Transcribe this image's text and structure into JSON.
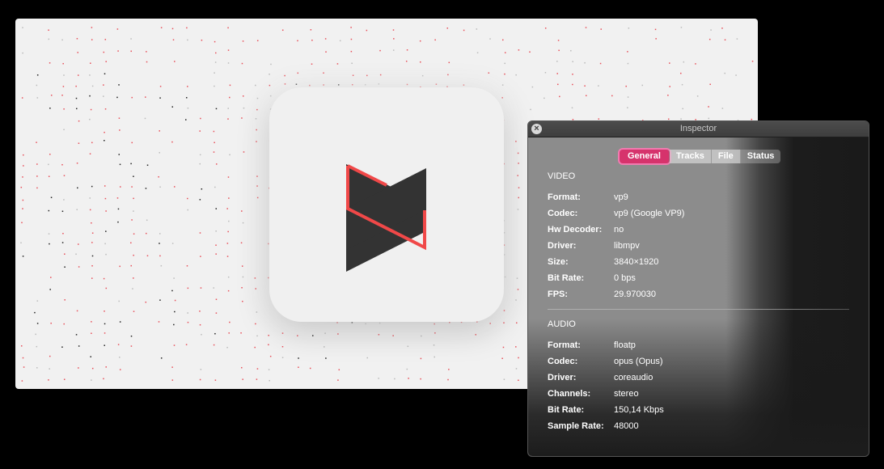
{
  "player": {
    "logo": "mpv-logo",
    "colors": {
      "background": "#f1f1f1",
      "accent_red": "#f04848",
      "logo_dark": "#333333"
    }
  },
  "inspector": {
    "title": "Inspector",
    "close_icon": "close-icon",
    "tabs": [
      {
        "label": "General",
        "active": true
      },
      {
        "label": "Tracks",
        "active": false
      },
      {
        "label": "File",
        "active": false
      },
      {
        "label": "Status",
        "active": false
      }
    ],
    "active_tab_color": "#d6336c",
    "video": {
      "title": "VIDEO",
      "rows": [
        {
          "label": "Format:",
          "value": "vp9"
        },
        {
          "label": "Codec:",
          "value": "vp9 (Google VP9)"
        },
        {
          "label": "Hw Decoder:",
          "value": "no"
        },
        {
          "label": "Driver:",
          "value": "libmpv"
        },
        {
          "label": "Size:",
          "value": "3840×1920"
        },
        {
          "label": "Bit Rate:",
          "value": "0 bps"
        },
        {
          "label": "FPS:",
          "value": "29.970030"
        }
      ]
    },
    "audio": {
      "title": "AUDIO",
      "rows": [
        {
          "label": "Format:",
          "value": "floatp"
        },
        {
          "label": "Codec:",
          "value": "opus (Opus)"
        },
        {
          "label": "Driver:",
          "value": "coreaudio"
        },
        {
          "label": "Channels:",
          "value": "stereo"
        },
        {
          "label": "Bit Rate:",
          "value": "150,14 Kbps"
        },
        {
          "label": "Sample Rate:",
          "value": "48000"
        }
      ]
    }
  }
}
